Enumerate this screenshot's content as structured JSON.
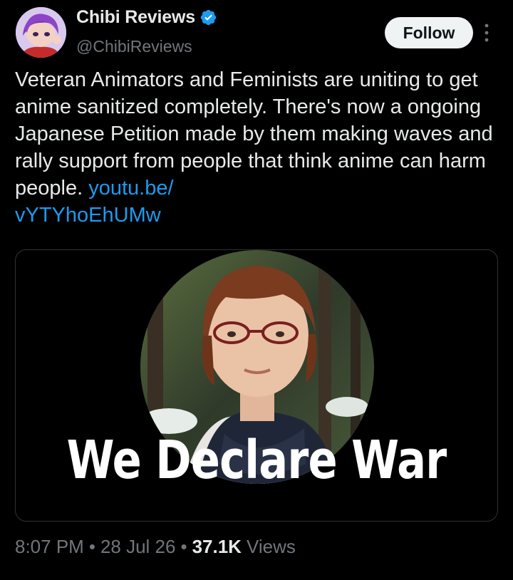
{
  "author": {
    "display_name": "Chibi Reviews",
    "handle": "@ChibiReviews",
    "verified_icon": "verified-badge-icon"
  },
  "actions": {
    "follow_label": "Follow",
    "more_icon": "more-vertical-icon"
  },
  "tweet": {
    "text": "Veteran Animators and Feminists are uniting to get anime sanitized completely. There's now a ongoing Japanese Petition made by them making waves and rally support from people that think anime can harm people. ",
    "link_line1": "youtu.be/",
    "link_line2": "vYTYhoEhUMw"
  },
  "media": {
    "caption": "We Declare War"
  },
  "meta": {
    "time": "8:07 PM",
    "separator": "•",
    "date": "28 Jul 26",
    "views_count": "37.1K",
    "views_label": "Views"
  },
  "colors": {
    "background": "#000000",
    "text": "#e7e9ea",
    "muted": "#71767b",
    "link": "#1d9bf0",
    "follow_bg": "#eff3f4"
  }
}
